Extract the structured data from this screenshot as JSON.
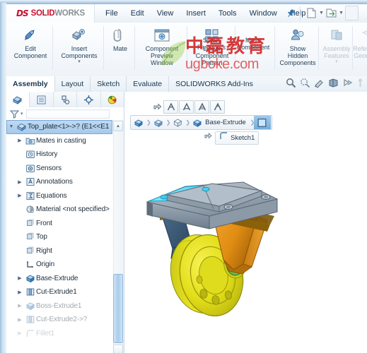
{
  "app": {
    "brand_ds": "DS",
    "brand_solid": "SOLID",
    "brand_works": "WORKS",
    "accent_red": "#c8102e",
    "accent_blue": "#2a6fb5",
    "selection_blue": "#a6c9ea"
  },
  "menu": {
    "items": [
      {
        "label": "File",
        "name": "menu-file"
      },
      {
        "label": "Edit",
        "name": "menu-edit"
      },
      {
        "label": "View",
        "name": "menu-view"
      },
      {
        "label": "Insert",
        "name": "menu-insert"
      },
      {
        "label": "Tools",
        "name": "menu-tools"
      },
      {
        "label": "Window",
        "name": "menu-window"
      },
      {
        "label": "Help",
        "name": "menu-help"
      }
    ],
    "pin_icon": "pushpin-icon",
    "quick_access": [
      {
        "name": "new-document-icon",
        "label": "New"
      },
      {
        "name": "open-document-icon",
        "label": "Open"
      },
      {
        "name": "save-icon",
        "label": "Save"
      }
    ]
  },
  "ribbon": {
    "buttons": [
      {
        "label": "Edit\nComponent",
        "label_line1": "Edit",
        "label_line2": "Component",
        "icon": "edit-component-icon",
        "dimmed": false,
        "dropdown": false
      },
      {
        "label_line1": "Insert",
        "label_line2": "Components",
        "icon": "insert-components-icon",
        "dimmed": false,
        "dropdown": true
      },
      {
        "label_line1": "Mate",
        "label_line2": "",
        "icon": "mate-icon",
        "dimmed": false,
        "dropdown": false
      },
      {
        "label_line1": "Component",
        "label_line2": "Preview",
        "label_line3": "Window",
        "icon": "component-preview-window-icon",
        "dimmed": false,
        "dropdown": false
      },
      {
        "label_line1": "Linear",
        "label_line2": "Component",
        "label_line3": "Pattern",
        "icon": "linear-component-pattern-icon",
        "dimmed": false,
        "dropdown": true
      },
      {
        "label_line1": "Smart",
        "label_line2": "Fasteners",
        "icon": "smart-fasteners-icon",
        "dimmed": false,
        "dropdown": false
      },
      {
        "label_line1": "Move",
        "label_line2": "Component",
        "icon": "move-component-icon",
        "dimmed": false,
        "dropdown": true
      },
      {
        "label_line1": "Show",
        "label_line2": "Hidden",
        "label_line3": "Components",
        "icon": "show-hidden-components-icon",
        "dimmed": false,
        "dropdown": false
      },
      {
        "label_line1": "Assembly",
        "label_line2": "Features",
        "icon": "assembly-features-icon",
        "dimmed": true,
        "dropdown": true
      },
      {
        "label_line1": "Reference",
        "label_line2": "Geometry",
        "icon": "reference-geometry-icon",
        "dimmed": true,
        "dropdown": true
      }
    ]
  },
  "command_tabs": {
    "items": [
      {
        "label": "Assembly",
        "active": true
      },
      {
        "label": "Layout",
        "active": false
      },
      {
        "label": "Sketch",
        "active": false
      },
      {
        "label": "Evaluate",
        "active": false
      },
      {
        "label": "SOLIDWORKS Add-Ins",
        "active": false
      }
    ],
    "view_tools": [
      {
        "name": "zoom-to-fit-icon"
      },
      {
        "name": "zoom-to-area-icon"
      },
      {
        "name": "previous-view-icon"
      },
      {
        "name": "section-view-icon"
      },
      {
        "name": "view-orientation-icon"
      },
      {
        "name": "display-style-icon"
      }
    ]
  },
  "tree_panel": {
    "tabs": [
      {
        "name": "feature-manager-tab",
        "label": "FeatureManager design tree",
        "active": true
      },
      {
        "name": "property-manager-tab",
        "label": "PropertyManager",
        "active": false
      },
      {
        "name": "configuration-manager-tab",
        "label": "ConfigurationManager",
        "active": false
      },
      {
        "name": "dimxpert-manager-tab",
        "label": "DimXpertManager",
        "active": false
      },
      {
        "name": "display-manager-tab",
        "label": "DisplayManager",
        "active": false
      }
    ],
    "filter": {
      "icon": "filter-icon",
      "placeholder": "",
      "value": ""
    },
    "items": [
      {
        "label": "Top_plate<1>->? (E1<<E1",
        "icon": "part-icon",
        "indent": 0,
        "twisty": "down",
        "selected": true,
        "state": "normal"
      },
      {
        "label": "Mates in casting",
        "icon": "mates-folder-icon",
        "indent": 1,
        "twisty": "right",
        "selected": false,
        "state": "normal"
      },
      {
        "label": "History",
        "icon": "history-icon",
        "indent": 1,
        "twisty": "",
        "selected": false,
        "state": "normal"
      },
      {
        "label": "Sensors",
        "icon": "sensors-icon",
        "indent": 1,
        "twisty": "",
        "selected": false,
        "state": "normal"
      },
      {
        "label": "Annotations",
        "icon": "annotations-icon",
        "indent": 1,
        "twisty": "right",
        "selected": false,
        "state": "normal"
      },
      {
        "label": "Equations",
        "icon": "equations-icon",
        "indent": 1,
        "twisty": "right",
        "selected": false,
        "state": "normal"
      },
      {
        "label": "Material <not specified>",
        "icon": "material-icon",
        "indent": 1,
        "twisty": "",
        "selected": false,
        "state": "normal"
      },
      {
        "label": "Front",
        "icon": "plane-icon",
        "indent": 1,
        "twisty": "",
        "selected": false,
        "state": "normal"
      },
      {
        "label": "Top",
        "icon": "plane-icon",
        "indent": 1,
        "twisty": "",
        "selected": false,
        "state": "normal"
      },
      {
        "label": "Right",
        "icon": "plane-icon",
        "indent": 1,
        "twisty": "",
        "selected": false,
        "state": "normal"
      },
      {
        "label": "Origin",
        "icon": "origin-icon",
        "indent": 1,
        "twisty": "",
        "selected": false,
        "state": "normal"
      },
      {
        "label": "Base-Extrude",
        "icon": "boss-extrude-icon",
        "indent": 1,
        "twisty": "right",
        "selected": false,
        "state": "normal"
      },
      {
        "label": "Cut-Extrude1",
        "icon": "cut-extrude-icon",
        "indent": 1,
        "twisty": "right",
        "selected": false,
        "state": "normal"
      },
      {
        "label": "Boss-Extrude1",
        "icon": "boss-extrude-icon",
        "indent": 1,
        "twisty": "right",
        "selected": false,
        "state": "faded"
      },
      {
        "label": "Cut-Extrude2->?",
        "icon": "cut-extrude-icon",
        "indent": 1,
        "twisty": "right",
        "selected": false,
        "state": "faded"
      },
      {
        "label": "Fillet1",
        "icon": "fillet-icon",
        "indent": 1,
        "twisty": "right",
        "selected": false,
        "state": "very-faded"
      }
    ],
    "scrollbar": {
      "name": "tree-vertical-scrollbar"
    }
  },
  "graphics": {
    "context_toolbar": [
      {
        "name": "next-selection-icon"
      },
      {
        "name": "mate-dimension-icon-1"
      },
      {
        "name": "mate-dimension-icon-2"
      },
      {
        "name": "mate-dimension-icon-3"
      },
      {
        "name": "mate-dimension-icon-4"
      }
    ],
    "breadcrumb": {
      "segments": [
        {
          "name": "crumb-assembly-icon",
          "label": ""
        },
        {
          "name": "crumb-subassembly-icon",
          "label": ""
        },
        {
          "name": "crumb-solid-body-icon",
          "label": ""
        },
        {
          "name": "crumb-feature-icon",
          "label": "Base-Extrude"
        }
      ],
      "selected_segment": "Base-Extrude",
      "end_icon": "face-selected-icon"
    },
    "sketch_crumb": {
      "pointer_icon": "select-pointer-icon",
      "sketch_icon": "sketch-icon",
      "label": "Sketch1"
    },
    "model": {
      "name": "caster-wheel-assembly",
      "colors": {
        "top_plate_highlight": "#45d3f2",
        "top_plate": "#9aa7b4",
        "plate_dark": "#6d7b8a",
        "fork_orange": "#e8911f",
        "fork_orange_dark": "#b86d12",
        "wheel_yellow": "#e6e21a",
        "wheel_yellow_dark": "#b7b412",
        "hub_green": "#6fbf4f",
        "hub_magenta": "#c0379a",
        "bracket_blue": "#3f5e7e"
      }
    }
  },
  "watermark": {
    "chinese_text": "中磊教育",
    "url_text": "ugboke.com",
    "color_cn": "#d42a2a",
    "color_url": "#e05b5b"
  }
}
